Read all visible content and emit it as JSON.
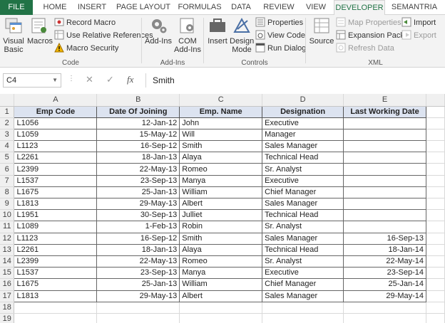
{
  "tabs": [
    "FILE",
    "HOME",
    "INSERT",
    "PAGE LAYOUT",
    "FORMULAS",
    "DATA",
    "REVIEW",
    "VIEW",
    "DEVELOPER",
    "SEMANTRIA"
  ],
  "ribbon": {
    "code": {
      "label": "Code",
      "visual_basic": "Visual Basic",
      "macros": "Macros",
      "record_macro": "Record Macro",
      "relative_refs": "Use Relative References",
      "macro_security": "Macro Security"
    },
    "addins": {
      "label": "Add-Ins",
      "add_ins": "Add-Ins",
      "com_add_ins": "COM Add-Ins"
    },
    "controls": {
      "label": "Controls",
      "insert": "Insert",
      "design_mode": "Design Mode",
      "properties": "Properties",
      "view_code": "View Code",
      "run_dialog": "Run Dialog"
    },
    "xml": {
      "label": "XML",
      "source": "Source",
      "map_properties": "Map Properties",
      "expansion_packs": "Expansion Packs",
      "refresh_data": "Refresh Data",
      "import": "Import",
      "export": "Export"
    }
  },
  "formula_bar": {
    "name_box": "C4",
    "cancel": "✕",
    "enter": "✓",
    "fx": "fx",
    "content": "Smith"
  },
  "columns": [
    "A",
    "B",
    "C",
    "D",
    "E"
  ],
  "headers": [
    "Emp Code",
    "Date Of Joining",
    "Emp. Name",
    "Designation",
    "Last Working Date"
  ],
  "rows": [
    [
      "L1056",
      "12-Jan-12",
      "John",
      "Executive",
      ""
    ],
    [
      "L1059",
      "15-May-12",
      "Will",
      "Manager",
      ""
    ],
    [
      "L1123",
      "16-Sep-12",
      "Smith",
      "Sales Manager",
      ""
    ],
    [
      "L2261",
      "18-Jan-13",
      "Alaya",
      "Technical Head",
      ""
    ],
    [
      "L2399",
      "22-May-13",
      "Romeo",
      "Sr. Analyst",
      ""
    ],
    [
      "L1537",
      "23-Sep-13",
      "Manya",
      "Executive",
      ""
    ],
    [
      "L1675",
      "25-Jan-13",
      "William",
      "Chief Manager",
      ""
    ],
    [
      "L1813",
      "29-May-13",
      "Albert",
      "Sales Manager",
      ""
    ],
    [
      "L1951",
      "30-Sep-13",
      "Julliet",
      "Technical Head",
      ""
    ],
    [
      "L1089",
      "1-Feb-13",
      "Robin",
      "Sr. Analyst",
      ""
    ],
    [
      "L1123",
      "16-Sep-12",
      "Smith",
      "Sales Manager",
      "16-Sep-13"
    ],
    [
      "L2261",
      "18-Jan-13",
      "Alaya",
      "Technical Head",
      "18-Jan-14"
    ],
    [
      "L2399",
      "22-May-13",
      "Romeo",
      "Sr. Analyst",
      "22-May-14"
    ],
    [
      "L1537",
      "23-Sep-13",
      "Manya",
      "Executive",
      "23-Sep-14"
    ],
    [
      "L1675",
      "25-Jan-13",
      "William",
      "Chief Manager",
      "25-Jan-14"
    ],
    [
      "L1813",
      "29-May-13",
      "Albert",
      "Sales Manager",
      "29-May-14"
    ]
  ],
  "row_numbers": [
    "1",
    "2",
    "3",
    "4",
    "5",
    "6",
    "7",
    "8",
    "9",
    "10",
    "11",
    "12",
    "13",
    "14",
    "15",
    "16",
    "17",
    "18",
    "19"
  ],
  "colors": {
    "accent": "#217346",
    "header_fill": "#dce3f0"
  }
}
